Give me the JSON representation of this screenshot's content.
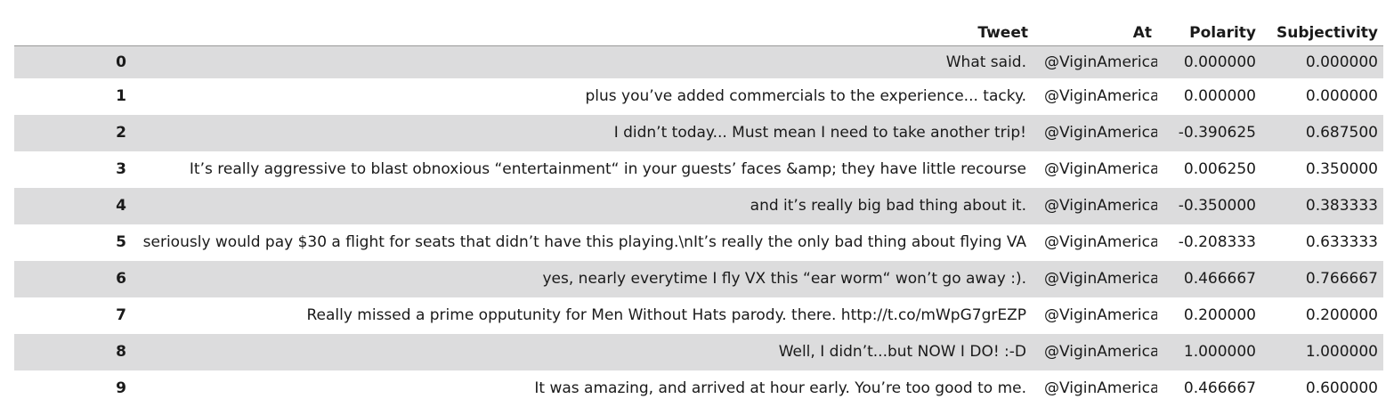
{
  "table": {
    "columns": [
      "Tweet",
      "At",
      "Polarity",
      "Subjectivity"
    ],
    "rows": [
      {
        "index": "0",
        "tweet": "What said.",
        "at": "@ViginAmerica",
        "polarity": "0.000000",
        "subjectivity": "0.000000"
      },
      {
        "index": "1",
        "tweet": "plus you’ve added commercials to the experience... tacky.",
        "at": "@ViginAmerica",
        "polarity": "0.000000",
        "subjectivity": "0.000000"
      },
      {
        "index": "2",
        "tweet": "I didn’t today... Must mean I need to take another trip!",
        "at": "@ViginAmerica",
        "polarity": "-0.390625",
        "subjectivity": "0.687500"
      },
      {
        "index": "3",
        "tweet": "It’s really aggressive to blast obnoxious “entertainment“ in your guests’ faces &amp; they have little recourse",
        "at": "@ViginAmerica",
        "polarity": "0.006250",
        "subjectivity": "0.350000"
      },
      {
        "index": "4",
        "tweet": "and it’s really big bad thing about it.",
        "at": "@ViginAmerica",
        "polarity": "-0.350000",
        "subjectivity": "0.383333"
      },
      {
        "index": "5",
        "tweet": "seriously would pay $30 a flight for seats that didn’t have this playing.\\nIt’s really the only bad thing about flying VA",
        "at": "@ViginAmerica",
        "polarity": "-0.208333",
        "subjectivity": "0.633333"
      },
      {
        "index": "6",
        "tweet": "yes, nearly everytime I fly VX this “ear worm“ won’t go away :).",
        "at": "@ViginAmerica",
        "polarity": "0.466667",
        "subjectivity": "0.766667"
      },
      {
        "index": "7",
        "tweet": "Really missed a prime opputunity for Men Without Hats parody. there. http://t.co/mWpG7grEZP",
        "at": "@ViginAmerica",
        "polarity": "0.200000",
        "subjectivity": "0.200000"
      },
      {
        "index": "8",
        "tweet": "Well, I didn’t...but NOW I DO! :-D",
        "at": "@ViginAmerica",
        "polarity": "1.000000",
        "subjectivity": "1.000000"
      },
      {
        "index": "9",
        "tweet": "It was amazing, and arrived at hour early. You’re too good to me.",
        "at": "@ViginAmerica",
        "polarity": "0.466667",
        "subjectivity": "0.600000"
      }
    ]
  },
  "colors": {
    "stripe": "#dcdcdd",
    "background": "#ffffff",
    "header_rule": "#999999"
  }
}
